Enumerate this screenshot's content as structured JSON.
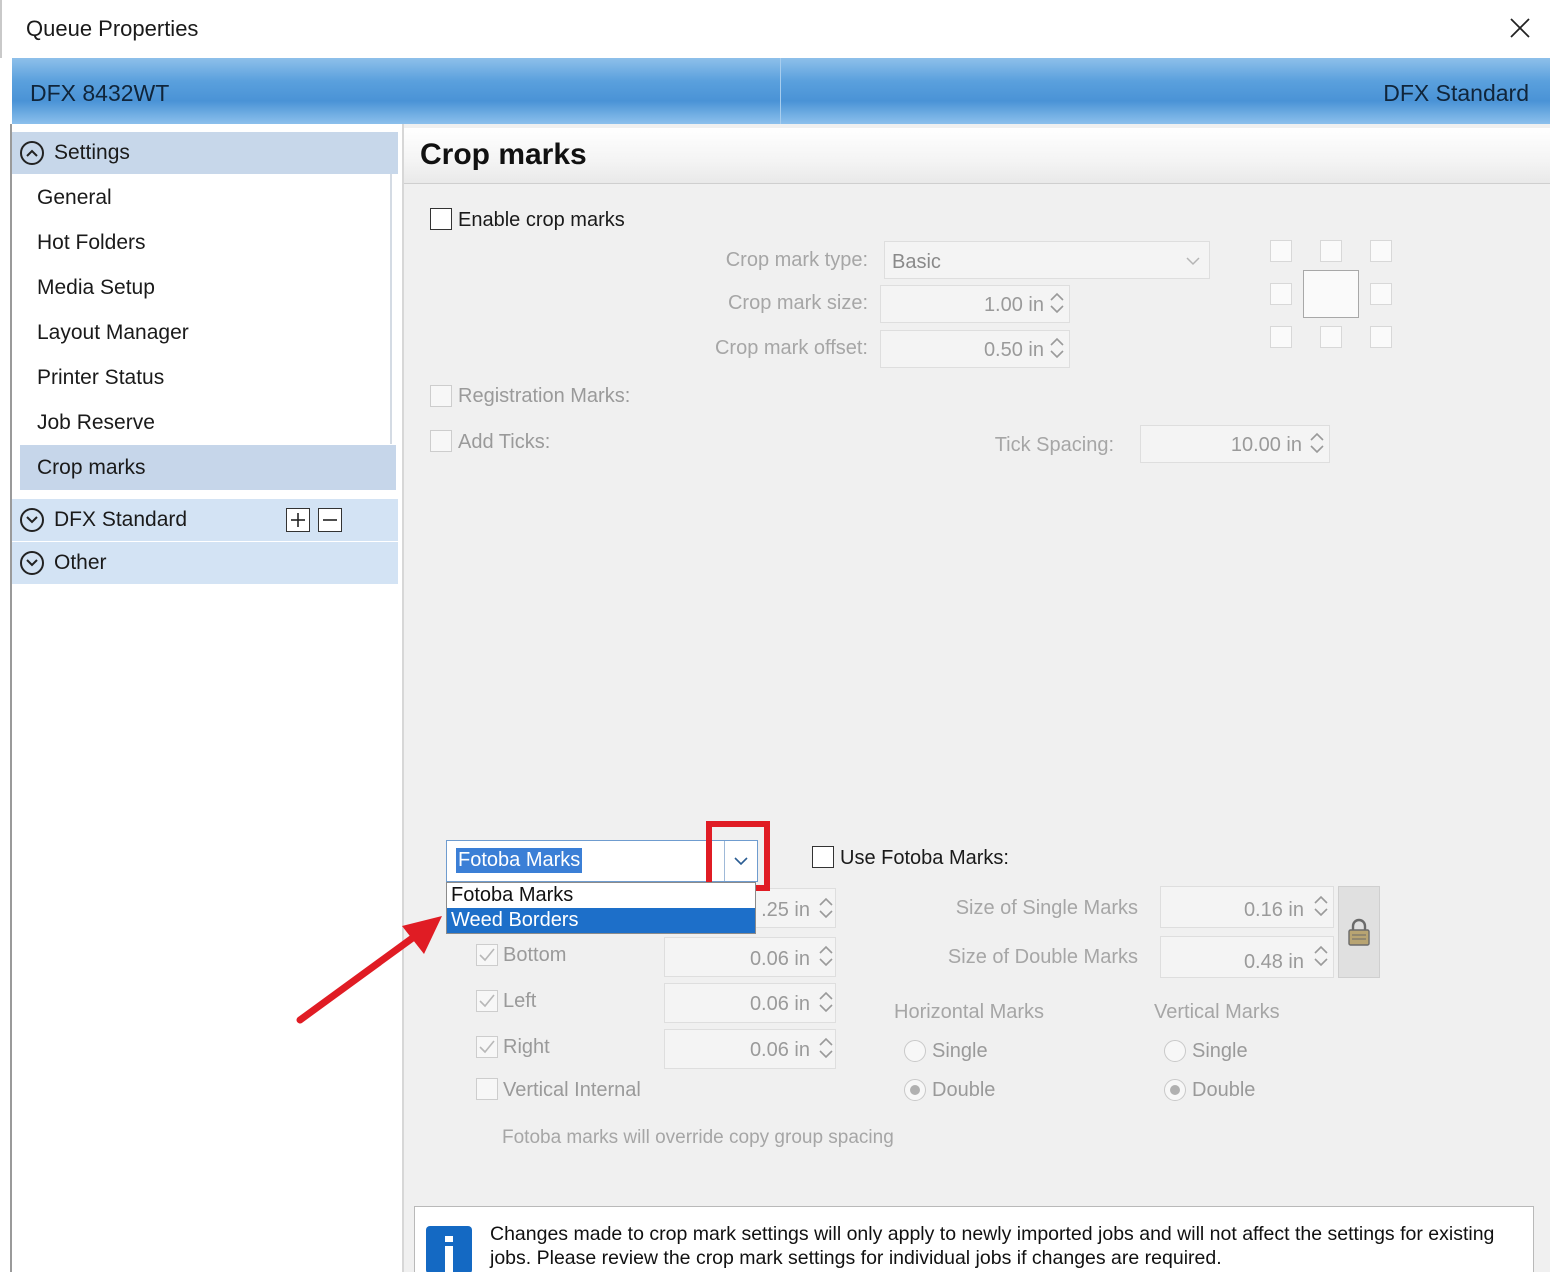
{
  "window": {
    "title": "Queue Properties"
  },
  "header": {
    "printer": "DFX 8432WT",
    "profile": "DFX Standard"
  },
  "sidebar": {
    "settings_label": "Settings",
    "items": [
      {
        "label": "General"
      },
      {
        "label": "Hot Folders"
      },
      {
        "label": "Media Setup"
      },
      {
        "label": "Layout Manager"
      },
      {
        "label": "Printer Status"
      },
      {
        "label": "Job Reserve"
      },
      {
        "label": "Crop marks"
      }
    ],
    "selected": "Crop marks",
    "dfx_label": "DFX Standard",
    "other_label": "Other"
  },
  "main": {
    "title": "Crop marks",
    "enable_crop_marks": "Enable crop marks",
    "crop_mark_type_label": "Crop mark type:",
    "crop_mark_type_value": "Basic",
    "crop_mark_size_label": "Crop mark size:",
    "crop_mark_size_value": "1.00 in",
    "crop_mark_offset_label": "Crop mark offset:",
    "crop_mark_offset_value": "0.50 in",
    "registration_marks": "Registration Marks:",
    "add_ticks": "Add Ticks:",
    "tick_spacing_label": "Tick Spacing:",
    "tick_spacing_value": "10.00 in"
  },
  "fotoba": {
    "combo_value": "Fotoba Marks",
    "options": [
      "Fotoba Marks",
      "Weed Borders"
    ],
    "highlighted_option": "Weed Borders",
    "use_fotoba_marks": "Use Fotoba Marks:",
    "top_value": ".25 in",
    "bottom_label": "Bottom",
    "bottom_value": "0.06 in",
    "left_label": "Left",
    "left_value": "0.06 in",
    "right_label": "Right",
    "right_value": "0.06 in",
    "vertical_internal": "Vertical Internal",
    "size_single_label": "Size of Single Marks",
    "size_single_value": "0.16 in",
    "size_double_label": "Size of Double Marks",
    "size_double_value": "0.48 in",
    "horizontal_marks": "Horizontal Marks",
    "vertical_marks": "Vertical Marks",
    "single": "Single",
    "double": "Double",
    "override_note": "Fotoba marks will override copy group spacing"
  },
  "info": {
    "line1": "Changes made to crop mark settings will only apply to newly imported jobs and will not affect the settings for existing",
    "line2": "jobs. Please review the crop mark settings for individual jobs if changes are required."
  },
  "colors": {
    "accent": "#4a93d6",
    "annotation": "#e01c24",
    "selection": "#1d6fc9"
  }
}
